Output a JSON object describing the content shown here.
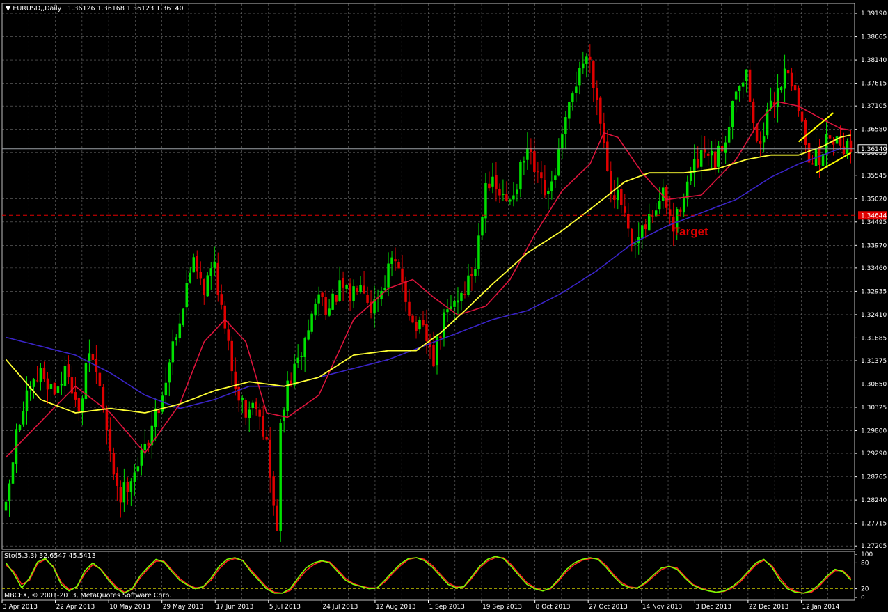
{
  "header": {
    "symbol_label": "EURUSD,,Daily",
    "ohlc": "1.36126 1.36168 1.36123 1.36140"
  },
  "stoch_header": "Sto(5,3,3) 32.6547 45.5413",
  "copyright": "MBCFX, © 2001-2013, MetaQuotes Software Corp.",
  "annotation": "Target",
  "price_labels": {
    "current": "1.36140",
    "target": "1.34644"
  },
  "colors": {
    "background": "#000000",
    "grid": "#8a8a8a",
    "bull": "#00e000",
    "bear": "#e00000",
    "ma_red": "#dc143c",
    "ma_yellow": "#ffff33",
    "ma_blue": "#3a24c8",
    "channel": "#ffff00",
    "target_line": "#e00000",
    "stoch_main": "#7cfc00",
    "stoch_signal": "#ff2020",
    "stoch_levels": "#c8c800"
  },
  "chart_data": [
    {
      "type": "candlestick",
      "title": "EURUSD,,Daily",
      "y_ticks": [
        "1.39190",
        "1.38665",
        "1.38140",
        "1.37615",
        "1.37105",
        "1.36580",
        "1.36055",
        "1.35545",
        "1.35020",
        "1.34495",
        "1.33970",
        "1.33460",
        "1.32935",
        "1.32410",
        "1.31885",
        "1.31375",
        "1.30850",
        "1.30325",
        "1.29800",
        "1.29290",
        "1.28765",
        "1.28240",
        "1.27715",
        "1.27205"
      ],
      "ylim": [
        1.2713,
        1.3941
      ],
      "x_ticks": [
        "3 Apr 2013",
        "22 Apr 2013",
        "10 May 2013",
        "29 May 2013",
        "17 Jun 2013",
        "5 Jul 2013",
        "24 Jul 2013",
        "12 Aug 2013",
        "1 Sep 2013",
        "19 Sep 2013",
        "8 Oct 2013",
        "27 Oct 2013",
        "14 Nov 2013",
        "3 Dec 2013",
        "22 Dec 2013",
        "12 Jan 2014"
      ],
      "close_path": [
        [
          0,
          1.28
        ],
        [
          3,
          1.297
        ],
        [
          6,
          1.305
        ],
        [
          10,
          1.311
        ],
        [
          14,
          1.307
        ],
        [
          18,
          1.312
        ],
        [
          21,
          1.301
        ],
        [
          24,
          1.316
        ],
        [
          27,
          1.308
        ],
        [
          30,
          1.292
        ],
        [
          33,
          1.283
        ],
        [
          36,
          1.288
        ],
        [
          39,
          1.292
        ],
        [
          42,
          1.299
        ],
        [
          45,
          1.306
        ],
        [
          48,
          1.318
        ],
        [
          51,
          1.326
        ],
        [
          54,
          1.338
        ],
        [
          57,
          1.33
        ],
        [
          60,
          1.336
        ],
        [
          63,
          1.32
        ],
        [
          66,
          1.309
        ],
        [
          69,
          1.302
        ],
        [
          72,
          1.305
        ],
        [
          75,
          1.295
        ],
        [
          77,
          1.28
        ],
        [
          78,
          1.277
        ],
        [
          79,
          1.298
        ],
        [
          81,
          1.308
        ],
        [
          84,
          1.313
        ],
        [
          87,
          1.321
        ],
        [
          90,
          1.329
        ],
        [
          93,
          1.325
        ],
        [
          96,
          1.33
        ],
        [
          99,
          1.328
        ],
        [
          102,
          1.333
        ],
        [
          105,
          1.326
        ],
        [
          108,
          1.33
        ],
        [
          111,
          1.336
        ],
        [
          114,
          1.332
        ],
        [
          117,
          1.322
        ],
        [
          120,
          1.32
        ],
        [
          123,
          1.314
        ],
        [
          126,
          1.323
        ],
        [
          129,
          1.327
        ],
        [
          132,
          1.33
        ],
        [
          135,
          1.335
        ],
        [
          138,
          1.355
        ],
        [
          141,
          1.352
        ],
        [
          144,
          1.349
        ],
        [
          147,
          1.354
        ],
        [
          150,
          1.361
        ],
        [
          153,
          1.354
        ],
        [
          156,
          1.35
        ],
        [
          159,
          1.36
        ],
        [
          162,
          1.37
        ],
        [
          165,
          1.38
        ],
        [
          168,
          1.382
        ],
        [
          171,
          1.368
        ],
        [
          174,
          1.353
        ],
        [
          177,
          1.349
        ],
        [
          180,
          1.338
        ],
        [
          183,
          1.342
        ],
        [
          186,
          1.347
        ],
        [
          189,
          1.351
        ],
        [
          192,
          1.343
        ],
        [
          195,
          1.352
        ],
        [
          198,
          1.357
        ],
        [
          201,
          1.36
        ],
        [
          204,
          1.358
        ],
        [
          207,
          1.364
        ],
        [
          210,
          1.376
        ],
        [
          213,
          1.378
        ],
        [
          216,
          1.362
        ],
        [
          219,
          1.368
        ],
        [
          222,
          1.375
        ],
        [
          225,
          1.38
        ],
        [
          228,
          1.37
        ],
        [
          231,
          1.36
        ],
        [
          234,
          1.359
        ],
        [
          237,
          1.365
        ],
        [
          240,
          1.363
        ],
        [
          243,
          1.3614
        ]
      ],
      "ma_red": [
        [
          0,
          1.292
        ],
        [
          10,
          1.3
        ],
        [
          20,
          1.308
        ],
        [
          30,
          1.302
        ],
        [
          40,
          1.293
        ],
        [
          50,
          1.304
        ],
        [
          57,
          1.318
        ],
        [
          63,
          1.323
        ],
        [
          69,
          1.318
        ],
        [
          75,
          1.302
        ],
        [
          81,
          1.301
        ],
        [
          90,
          1.306
        ],
        [
          100,
          1.323
        ],
        [
          110,
          1.33
        ],
        [
          117,
          1.332
        ],
        [
          123,
          1.328
        ],
        [
          130,
          1.324
        ],
        [
          138,
          1.326
        ],
        [
          145,
          1.332
        ],
        [
          152,
          1.342
        ],
        [
          160,
          1.352
        ],
        [
          168,
          1.358
        ],
        [
          172,
          1.365
        ],
        [
          176,
          1.364
        ],
        [
          183,
          1.356
        ],
        [
          190,
          1.35
        ],
        [
          200,
          1.351
        ],
        [
          210,
          1.359
        ],
        [
          217,
          1.368
        ],
        [
          222,
          1.372
        ],
        [
          228,
          1.371
        ],
        [
          235,
          1.368
        ],
        [
          240,
          1.366
        ],
        [
          243,
          1.3656
        ]
      ],
      "ma_yellow": [
        [
          0,
          1.314
        ],
        [
          10,
          1.305
        ],
        [
          20,
          1.302
        ],
        [
          30,
          1.303
        ],
        [
          40,
          1.302
        ],
        [
          50,
          1.304
        ],
        [
          60,
          1.307
        ],
        [
          70,
          1.309
        ],
        [
          80,
          1.308
        ],
        [
          90,
          1.31
        ],
        [
          100,
          1.315
        ],
        [
          110,
          1.316
        ],
        [
          118,
          1.316
        ],
        [
          125,
          1.32
        ],
        [
          132,
          1.325
        ],
        [
          140,
          1.331
        ],
        [
          150,
          1.338
        ],
        [
          160,
          1.343
        ],
        [
          170,
          1.349
        ],
        [
          178,
          1.354
        ],
        [
          185,
          1.356
        ],
        [
          195,
          1.356
        ],
        [
          205,
          1.357
        ],
        [
          213,
          1.359
        ],
        [
          220,
          1.36
        ],
        [
          228,
          1.36
        ],
        [
          235,
          1.362
        ],
        [
          240,
          1.364
        ],
        [
          243,
          1.3645
        ]
      ],
      "ma_blue": [
        [
          0,
          1.319
        ],
        [
          10,
          1.317
        ],
        [
          20,
          1.315
        ],
        [
          30,
          1.311
        ],
        [
          40,
          1.306
        ],
        [
          50,
          1.303
        ],
        [
          60,
          1.305
        ],
        [
          70,
          1.308
        ],
        [
          80,
          1.308
        ],
        [
          90,
          1.31
        ],
        [
          100,
          1.312
        ],
        [
          110,
          1.314
        ],
        [
          120,
          1.317
        ],
        [
          130,
          1.32
        ],
        [
          140,
          1.323
        ],
        [
          150,
          1.325
        ],
        [
          160,
          1.329
        ],
        [
          170,
          1.334
        ],
        [
          180,
          1.34
        ],
        [
          190,
          1.344
        ],
        [
          200,
          1.347
        ],
        [
          210,
          1.35
        ],
        [
          220,
          1.355
        ],
        [
          228,
          1.358
        ],
        [
          235,
          1.36
        ],
        [
          240,
          1.3615
        ],
        [
          243,
          1.3615
        ]
      ],
      "channel": {
        "upper": [
          [
            228,
            1.363
          ],
          [
            238,
            1.3695
          ]
        ],
        "lower": [
          [
            233,
            1.356
          ],
          [
            243,
            1.3605
          ]
        ]
      },
      "target_level": 1.34644,
      "current_level": 1.3614
    },
    {
      "type": "line",
      "title": "Sto(5,3,3) 32.6547 45.5413",
      "y_ticks": [
        "100",
        "80",
        "20",
        "0"
      ],
      "ylim": [
        0,
        100
      ],
      "levels": [
        80,
        20
      ],
      "series": [
        {
          "values": [
            80,
            55,
            22,
            45,
            82,
            90,
            70,
            30,
            15,
            25,
            62,
            80,
            65,
            40,
            20,
            10,
            20,
            50,
            70,
            88,
            82,
            60,
            40,
            28,
            20,
            25,
            45,
            72,
            88,
            92,
            85,
            60,
            40,
            20,
            10,
            10,
            20,
            45,
            68,
            80,
            85,
            80,
            60,
            40,
            30,
            25,
            20,
            22,
            40,
            60,
            78,
            90,
            92,
            85,
            70,
            50,
            30,
            22,
            25,
            48,
            72,
            88,
            95,
            90,
            72,
            50,
            30,
            20,
            15,
            22,
            42,
            65,
            80,
            88,
            92,
            88,
            70,
            48,
            30,
            22,
            22,
            35,
            52,
            68,
            72,
            65,
            45,
            28,
            20,
            15,
            12,
            15,
            25,
            40,
            60,
            80,
            88,
            70,
            40,
            20,
            12,
            10,
            15,
            30,
            50,
            65,
            60,
            40
          ]
        },
        {
          "values": [
            75,
            60,
            30,
            40,
            78,
            88,
            72,
            35,
            18,
            24,
            55,
            76,
            66,
            44,
            24,
            12,
            18,
            45,
            66,
            84,
            84,
            64,
            44,
            30,
            22,
            24,
            40,
            66,
            84,
            90,
            86,
            64,
            44,
            24,
            12,
            10,
            16,
            40,
            62,
            76,
            84,
            82,
            64,
            44,
            32,
            26,
            22,
            22,
            36,
            56,
            74,
            88,
            92,
            88,
            74,
            54,
            34,
            24,
            24,
            44,
            68,
            84,
            92,
            92,
            76,
            54,
            34,
            22,
            16,
            20,
            38,
            60,
            76,
            86,
            90,
            90,
            74,
            52,
            34,
            24,
            22,
            32,
            48,
            64,
            72,
            68,
            48,
            30,
            22,
            16,
            12,
            14,
            22,
            36,
            56,
            76,
            86,
            74,
            46,
            24,
            14,
            10,
            12,
            26,
            46,
            62,
            62,
            44
          ]
        }
      ]
    }
  ]
}
